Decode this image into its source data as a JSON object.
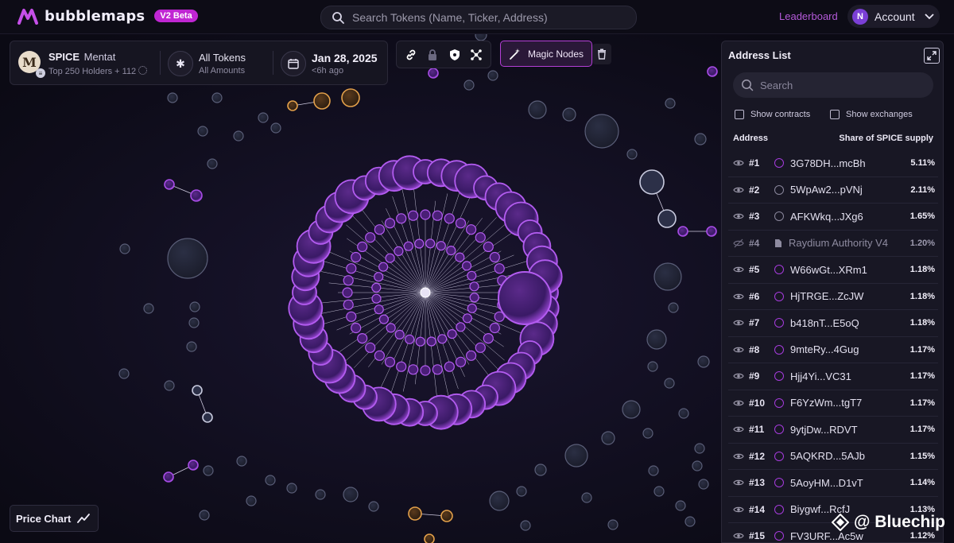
{
  "app": {
    "name": "bubblemaps",
    "badge": "V2 Beta"
  },
  "header": {
    "search_placeholder": "Search Tokens (Name, Ticker, Address)",
    "leaderboard_label": "Leaderboard",
    "account_initial": "N",
    "account_label": "Account"
  },
  "token": {
    "avatar_letter": "M",
    "symbol": "SPICE",
    "name": "Mentat",
    "holders": "Top 250 Holders + 112",
    "filter_title": "All Tokens",
    "filter_sub": "All Amounts",
    "date": "Jan 28, 2025",
    "date_sub": "<6h ago"
  },
  "toolbar": {
    "tools": [
      "link-icon",
      "lock-icon",
      "shield-icon",
      "network-icon"
    ],
    "magic_label": "Magic Nodes"
  },
  "address_list": {
    "title": "Address List",
    "search_placeholder": "Search",
    "show_contracts": "Show contracts",
    "show_exchanges": "Show exchanges",
    "col_address": "Address",
    "col_share": "Share of SPICE supply",
    "rows": [
      {
        "rank": "#1",
        "address": "3G78DH...mcBh",
        "share": "5.11%",
        "dot": "purple"
      },
      {
        "rank": "#2",
        "address": "5WpAw2...pVNj",
        "share": "2.11%",
        "dot": "gray"
      },
      {
        "rank": "#3",
        "address": "AFKWkq...JXg6",
        "share": "1.65%",
        "dot": "gray"
      },
      {
        "rank": "#4",
        "address": "Raydium Authority V4",
        "share": "1.20%",
        "dot": "doc",
        "dim": true
      },
      {
        "rank": "#5",
        "address": "W66wGt...XRm1",
        "share": "1.18%",
        "dot": "purple"
      },
      {
        "rank": "#6",
        "address": "HjTRGE...ZcJW",
        "share": "1.18%",
        "dot": "purple"
      },
      {
        "rank": "#7",
        "address": "b418nT...E5oQ",
        "share": "1.18%",
        "dot": "purple"
      },
      {
        "rank": "#8",
        "address": "9mteRy...4Gug",
        "share": "1.17%",
        "dot": "purple"
      },
      {
        "rank": "#9",
        "address": "Hjj4Yi...VC31",
        "share": "1.17%",
        "dot": "purple"
      },
      {
        "rank": "#10",
        "address": "F6YzWm...tgT7",
        "share": "1.17%",
        "dot": "purple"
      },
      {
        "rank": "#11",
        "address": "9ytjDw...RDVT",
        "share": "1.17%",
        "dot": "purple"
      },
      {
        "rank": "#12",
        "address": "5AQKRD...5AJb",
        "share": "1.15%",
        "dot": "purple"
      },
      {
        "rank": "#13",
        "address": "5AoyHM...D1vT",
        "share": "1.14%",
        "dot": "purple"
      },
      {
        "rank": "#14",
        "address": "Biygwf...RcfJ",
        "share": "1.13%",
        "dot": "purple"
      },
      {
        "rank": "#15",
        "address": "FV3URF...Ac5w",
        "share": "1.12%",
        "dot": "purple"
      }
    ]
  },
  "price_chart_label": "Price Chart",
  "watermark": "@ Bluechip",
  "colors": {
    "accent": "#a53bdc",
    "gold": "#e3a04a",
    "badge": "#c026d3"
  }
}
